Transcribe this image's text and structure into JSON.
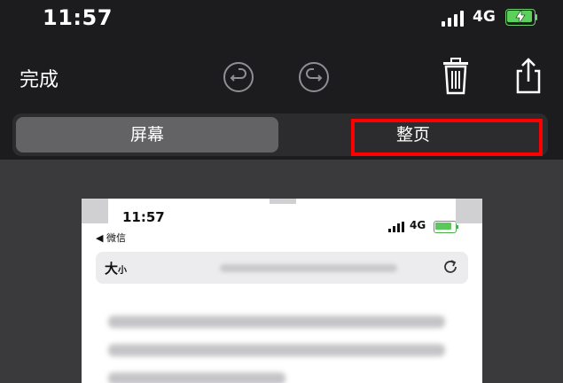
{
  "status_bar": {
    "time": "11:57",
    "network": "4G"
  },
  "toolbar": {
    "done_label": "完成"
  },
  "segmented": {
    "screen_label": "屏幕",
    "fullpage_label": "整页",
    "selected": "屏幕"
  },
  "preview": {
    "time": "11:57",
    "back_label": "◀ 微信",
    "network": "4G",
    "font_label_big": "大",
    "font_label_small": "小"
  },
  "colors": {
    "highlight": "#ff0000",
    "battery": "#5bd15b",
    "background": "#3a3a3c"
  },
  "icons": [
    "undo-icon",
    "redo-icon",
    "trash-icon",
    "share-icon",
    "reload-icon",
    "battery-icon",
    "signal-icon"
  ]
}
